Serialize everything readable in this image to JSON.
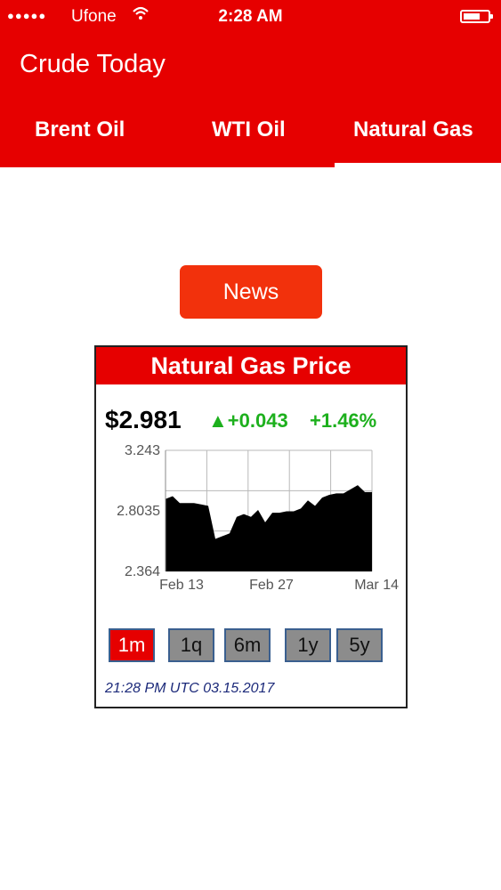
{
  "status_bar": {
    "carrier": "Ufone",
    "time": "2:28 AM"
  },
  "app": {
    "title": "Crude Today"
  },
  "tabs": [
    "Brent Oil",
    "WTI Oil",
    "Natural Gas"
  ],
  "news_button": "News",
  "card": {
    "title": "Natural Gas Price",
    "price": "$2.981",
    "change": "▲+0.043",
    "change_pct": "+1.46%",
    "ranges": [
      "1m",
      "1q",
      "6m",
      "1y",
      "5y"
    ],
    "active_range": "1m",
    "timestamp": "21:28 PM UTC 03.15.2017"
  },
  "chart_data": {
    "type": "area",
    "x_tick_labels": [
      "Feb 13",
      "Feb 27",
      "Mar 14"
    ],
    "y_tick_labels": [
      "3.243",
      "2.8035",
      "2.364"
    ],
    "ylim": [
      2.364,
      3.243
    ],
    "grid": true,
    "fill_color": "#000000",
    "values": [
      2.89,
      2.91,
      2.86,
      2.86,
      2.86,
      2.85,
      2.84,
      2.6,
      2.62,
      2.64,
      2.76,
      2.78,
      2.76,
      2.81,
      2.72,
      2.79,
      2.79,
      2.8,
      2.8,
      2.82,
      2.88,
      2.84,
      2.9,
      2.92,
      2.93,
      2.93,
      2.96,
      2.99,
      2.94,
      2.94
    ]
  },
  "colors": {
    "brand_red": "#e60000",
    "news_button": "#f2310c",
    "positive": "#1db01d",
    "timestamp": "#1c2a7a"
  }
}
